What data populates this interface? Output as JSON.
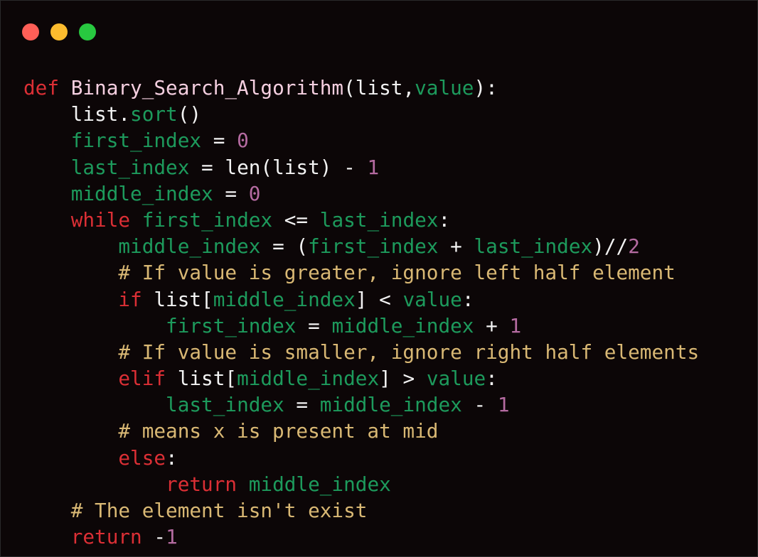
{
  "window_controls": {
    "close_color": "#ff5f57",
    "minimize_color": "#fcbc2e",
    "maximize_color": "#28c840"
  },
  "code": {
    "language": "python",
    "lines": [
      [
        {
          "t": "def",
          "c": "kw"
        },
        {
          "t": " ",
          "c": "txt"
        },
        {
          "t": "Binary_Search_Algorithm",
          "c": "fn"
        },
        {
          "t": "(list,",
          "c": "txt"
        },
        {
          "t": "value",
          "c": "var"
        },
        {
          "t": "):",
          "c": "txt"
        }
      ],
      [
        {
          "t": "    list.",
          "c": "txt"
        },
        {
          "t": "sort",
          "c": "var"
        },
        {
          "t": "()",
          "c": "txt"
        }
      ],
      [
        {
          "t": "    ",
          "c": "txt"
        },
        {
          "t": "first_index",
          "c": "var"
        },
        {
          "t": " = ",
          "c": "txt"
        },
        {
          "t": "0",
          "c": "num"
        }
      ],
      [
        {
          "t": "    ",
          "c": "txt"
        },
        {
          "t": "last_index",
          "c": "var"
        },
        {
          "t": " = len(list) - ",
          "c": "txt"
        },
        {
          "t": "1",
          "c": "num"
        }
      ],
      [
        {
          "t": "    ",
          "c": "txt"
        },
        {
          "t": "middle_index",
          "c": "var"
        },
        {
          "t": " = ",
          "c": "txt"
        },
        {
          "t": "0",
          "c": "num"
        }
      ],
      [
        {
          "t": "    ",
          "c": "txt"
        },
        {
          "t": "while",
          "c": "kw"
        },
        {
          "t": " ",
          "c": "txt"
        },
        {
          "t": "first_index",
          "c": "var"
        },
        {
          "t": " <= ",
          "c": "txt"
        },
        {
          "t": "last_index",
          "c": "var"
        },
        {
          "t": ":",
          "c": "txt"
        }
      ],
      [
        {
          "t": "        ",
          "c": "txt"
        },
        {
          "t": "middle_index",
          "c": "var"
        },
        {
          "t": " = (",
          "c": "txt"
        },
        {
          "t": "first_index",
          "c": "var"
        },
        {
          "t": " + ",
          "c": "txt"
        },
        {
          "t": "last_index",
          "c": "var"
        },
        {
          "t": ")//",
          "c": "txt"
        },
        {
          "t": "2",
          "c": "num"
        }
      ],
      [
        {
          "t": "        ",
          "c": "txt"
        },
        {
          "t": "# If value is greater, ignore left half element",
          "c": "cmt"
        }
      ],
      [
        {
          "t": "        ",
          "c": "txt"
        },
        {
          "t": "if",
          "c": "kw"
        },
        {
          "t": " list[",
          "c": "txt"
        },
        {
          "t": "middle_index",
          "c": "var"
        },
        {
          "t": "] < ",
          "c": "txt"
        },
        {
          "t": "value",
          "c": "var"
        },
        {
          "t": ":",
          "c": "txt"
        }
      ],
      [
        {
          "t": "            ",
          "c": "txt"
        },
        {
          "t": "first_index",
          "c": "var"
        },
        {
          "t": " = ",
          "c": "txt"
        },
        {
          "t": "middle_index",
          "c": "var"
        },
        {
          "t": " + ",
          "c": "txt"
        },
        {
          "t": "1",
          "c": "num"
        }
      ],
      [
        {
          "t": "        ",
          "c": "txt"
        },
        {
          "t": "# If value is smaller, ignore right half elements",
          "c": "cmt"
        }
      ],
      [
        {
          "t": "        ",
          "c": "txt"
        },
        {
          "t": "elif",
          "c": "kw"
        },
        {
          "t": " list[",
          "c": "txt"
        },
        {
          "t": "middle_index",
          "c": "var"
        },
        {
          "t": "] > ",
          "c": "txt"
        },
        {
          "t": "value",
          "c": "var"
        },
        {
          "t": ":",
          "c": "txt"
        }
      ],
      [
        {
          "t": "            ",
          "c": "txt"
        },
        {
          "t": "last_index",
          "c": "var"
        },
        {
          "t": " = ",
          "c": "txt"
        },
        {
          "t": "middle_index",
          "c": "var"
        },
        {
          "t": " - ",
          "c": "txt"
        },
        {
          "t": "1",
          "c": "num"
        }
      ],
      [
        {
          "t": "        ",
          "c": "txt"
        },
        {
          "t": "# means x is present at mid",
          "c": "cmt"
        }
      ],
      [
        {
          "t": "        ",
          "c": "txt"
        },
        {
          "t": "else",
          "c": "kw"
        },
        {
          "t": ":",
          "c": "txt"
        }
      ],
      [
        {
          "t": "            ",
          "c": "txt"
        },
        {
          "t": "return",
          "c": "kw"
        },
        {
          "t": " ",
          "c": "txt"
        },
        {
          "t": "middle_index",
          "c": "var"
        }
      ],
      [
        {
          "t": "    ",
          "c": "txt"
        },
        {
          "t": "# The element isn't exist",
          "c": "cmt"
        }
      ],
      [
        {
          "t": "    ",
          "c": "txt"
        },
        {
          "t": "return",
          "c": "kw"
        },
        {
          "t": " -",
          "c": "txt"
        },
        {
          "t": "1",
          "c": "num"
        }
      ]
    ]
  },
  "colors": {
    "background": "#0c0607",
    "keyword": "#dc2f35",
    "function_name": "#f5cfe0",
    "variable": "#1d9a5c",
    "number": "#b56ba1",
    "comment": "#d9b874",
    "text": "#f2f2f2"
  }
}
